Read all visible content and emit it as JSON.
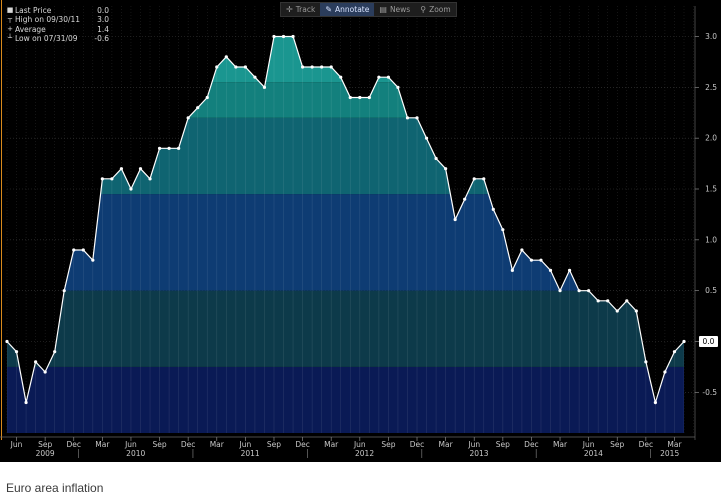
{
  "toolbar": {
    "buttons": [
      {
        "label": "Track",
        "icon": "crosshair-icon",
        "active": false
      },
      {
        "label": "Annotate",
        "icon": "pencil-icon",
        "active": true
      },
      {
        "label": "News",
        "icon": "news-icon",
        "active": false
      },
      {
        "label": "Zoom",
        "icon": "magnifier-icon",
        "active": false
      }
    ]
  },
  "legend": [
    {
      "marker": "■",
      "label": "Last Price",
      "value": "0.0"
    },
    {
      "marker": "┬",
      "label": "High on 09/30/11",
      "value": "3.0"
    },
    {
      "marker": "+",
      "label": "Average",
      "value": "1.4"
    },
    {
      "marker": "┴",
      "label": "Low on 07/31/09",
      "value": "-0.6"
    }
  ],
  "caption": "Euro area inflation",
  "colors": {
    "background": "#000000",
    "line": "#ffffff",
    "last_price_badge": "#ffffff"
  },
  "chart_data": {
    "type": "area",
    "title": "",
    "xlabel": "",
    "ylabel": "",
    "ylim": [
      -0.9,
      3.3
    ],
    "yticks": [
      -0.5,
      0.0,
      0.5,
      1.0,
      1.5,
      2.0,
      2.5,
      3.0
    ],
    "ytick_labels": [
      "-0.5",
      "0.0",
      "0.5",
      "1.0",
      "1.5",
      "2.0",
      "2.5",
      "3.0"
    ],
    "last_value_label": "0.0",
    "month_labels": [
      "Jun",
      "Sep",
      "Dec",
      "Mar",
      "Jun",
      "Sep",
      "Dec",
      "Mar",
      "Jun",
      "Sep",
      "Dec",
      "Mar",
      "Jun",
      "Sep",
      "Dec",
      "Mar",
      "Jun",
      "Sep",
      "Dec",
      "Mar",
      "Jun",
      "Sep",
      "Dec",
      "Mar",
      "Jun",
      "Sep",
      "Dec",
      "Mar"
    ],
    "year_labels": [
      "2009",
      "2010",
      "2011",
      "2012",
      "2013",
      "2014",
      "2015"
    ],
    "series": [
      {
        "x": [
          "2009-05",
          "2009-06",
          "2009-07",
          "2009-08",
          "2009-09",
          "2009-10",
          "2009-11",
          "2009-12",
          "2010-01",
          "2010-02",
          "2010-03",
          "2010-04",
          "2010-05",
          "2010-06",
          "2010-07",
          "2010-08",
          "2010-09",
          "2010-10",
          "2010-11",
          "2010-12",
          "2011-01",
          "2011-02",
          "2011-03",
          "2011-04",
          "2011-05",
          "2011-06",
          "2011-07",
          "2011-08",
          "2011-09",
          "2011-10",
          "2011-11",
          "2011-12",
          "2012-01",
          "2012-02",
          "2012-03",
          "2012-04",
          "2012-05",
          "2012-06",
          "2012-07",
          "2012-08",
          "2012-09",
          "2012-10",
          "2012-11",
          "2012-12",
          "2013-01",
          "2013-02",
          "2013-03",
          "2013-04",
          "2013-05",
          "2013-06",
          "2013-07",
          "2013-08",
          "2013-09",
          "2013-10",
          "2013-11",
          "2013-12",
          "2014-01",
          "2014-02",
          "2014-03",
          "2014-04",
          "2014-05",
          "2014-06",
          "2014-07",
          "2014-08",
          "2014-09",
          "2014-10",
          "2014-11",
          "2014-12",
          "2015-01",
          "2015-02",
          "2015-03",
          "2015-04"
        ],
        "values": [
          0.0,
          -0.1,
          -0.6,
          -0.2,
          -0.3,
          -0.1,
          0.5,
          0.9,
          0.9,
          0.8,
          1.6,
          1.6,
          1.7,
          1.5,
          1.7,
          1.6,
          1.9,
          1.9,
          1.9,
          2.2,
          2.3,
          2.4,
          2.7,
          2.8,
          2.7,
          2.7,
          2.6,
          2.5,
          3.0,
          3.0,
          3.0,
          2.7,
          2.7,
          2.7,
          2.7,
          2.6,
          2.4,
          2.4,
          2.4,
          2.6,
          2.6,
          2.5,
          2.2,
          2.2,
          2.0,
          1.8,
          1.7,
          1.2,
          1.4,
          1.6,
          1.6,
          1.3,
          1.1,
          0.7,
          0.9,
          0.8,
          0.8,
          0.7,
          0.5,
          0.7,
          0.5,
          0.5,
          0.4,
          0.4,
          0.3,
          0.4,
          0.3,
          -0.2,
          -0.6,
          -0.3,
          -0.1,
          0.0
        ]
      }
    ]
  }
}
